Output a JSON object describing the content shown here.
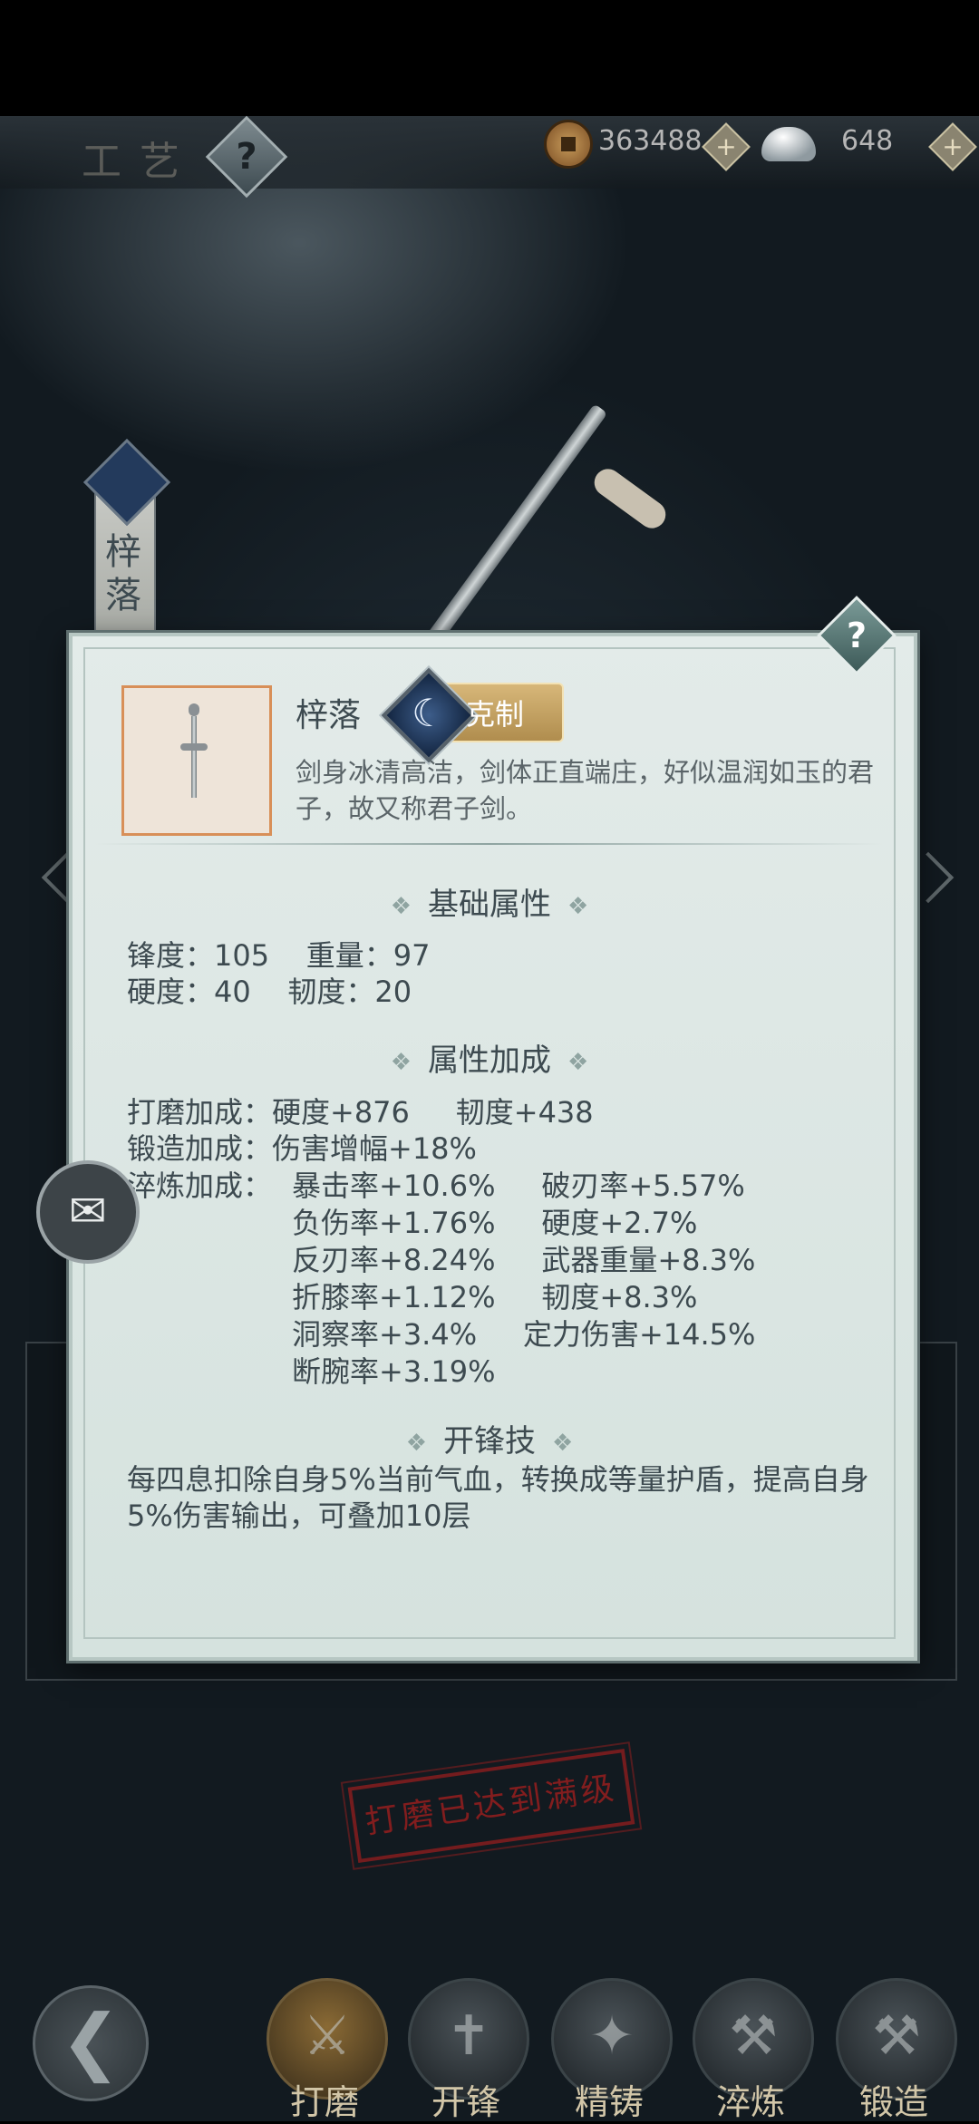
{
  "header": {
    "title_deco": "工艺",
    "coins": "363488",
    "silver": "648",
    "help_icon": "?",
    "plus_icon": "+"
  },
  "banner": {
    "name_vertical": "梓落"
  },
  "dialog": {
    "item_name": "梓落",
    "counter_label": "克制",
    "description": "剑身冰清高洁，剑体正直端庄，好似温润如玉的君子，故又称君子剑。",
    "section_basic": "基础属性",
    "basic_line1": "锋度：105    重量：97",
    "basic_line2": "硬度：40    韧度：20",
    "section_bonus": "属性加成",
    "grind_bonus": "打磨加成：硬度+876     韧度+438",
    "forge_bonus": "锻造加成：伤害增幅+18%",
    "temper_label": "淬炼加成：",
    "temper_lines": [
      "暴击率+10.6%     破刃率+5.57%",
      "负伤率+1.76%     硬度+2.7%",
      "反刃率+8.24%     武器重量+8.3%",
      "折膝率+1.12%     韧度+8.3%",
      "洞察率+3.4%     定力伤害+14.5%",
      "断腕率+3.19%"
    ],
    "section_skill": "开锋技",
    "skill_desc": "每四息扣除自身5%当前气血，转换成等量护盾，提高自身5%伤害输出，可叠加10层"
  },
  "stamp": "打磨已达到满级",
  "nav": {
    "tabs": [
      {
        "label": "打磨"
      },
      {
        "label": "开锋"
      },
      {
        "label": "精铸"
      },
      {
        "label": "淬炼"
      },
      {
        "label": "锻造"
      }
    ]
  },
  "colors": {
    "accent_gold": "#b08d4e",
    "item_border": "#d88f58",
    "stamp_red": "#961e1e"
  }
}
